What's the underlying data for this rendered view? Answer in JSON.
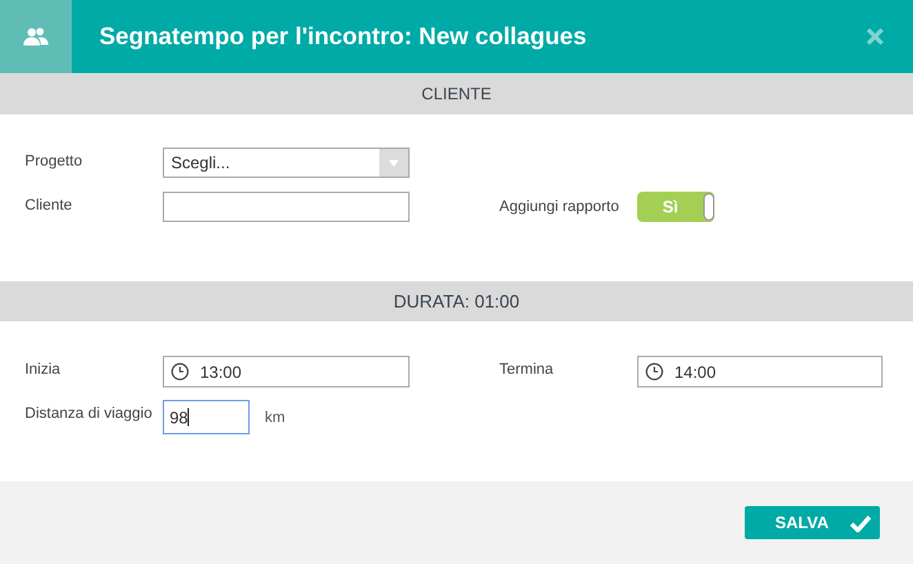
{
  "window": {
    "title": "Segnatempo per l'incontro: New collagues"
  },
  "sections": [
    {
      "title": "CLIENTE"
    },
    {
      "title": "DURATA: 01:00"
    }
  ],
  "progetto": {
    "label": "Progetto",
    "value": "Scegli..."
  },
  "cliente": {
    "label": "Cliente"
  },
  "aggiungi_rapporto": {
    "label": "Aggiungi rapporto",
    "on": true,
    "text": "Sì"
  },
  "inizia": {
    "label": "Inizia",
    "value": "13:00"
  },
  "termina": {
    "label": "Termina",
    "value": "14:00"
  },
  "distanza": {
    "label": "Distanza di viaggio",
    "value": "98",
    "unit": "km",
    "focused": true
  },
  "buttons": [
    {
      "label": "SALVA"
    }
  ]
}
